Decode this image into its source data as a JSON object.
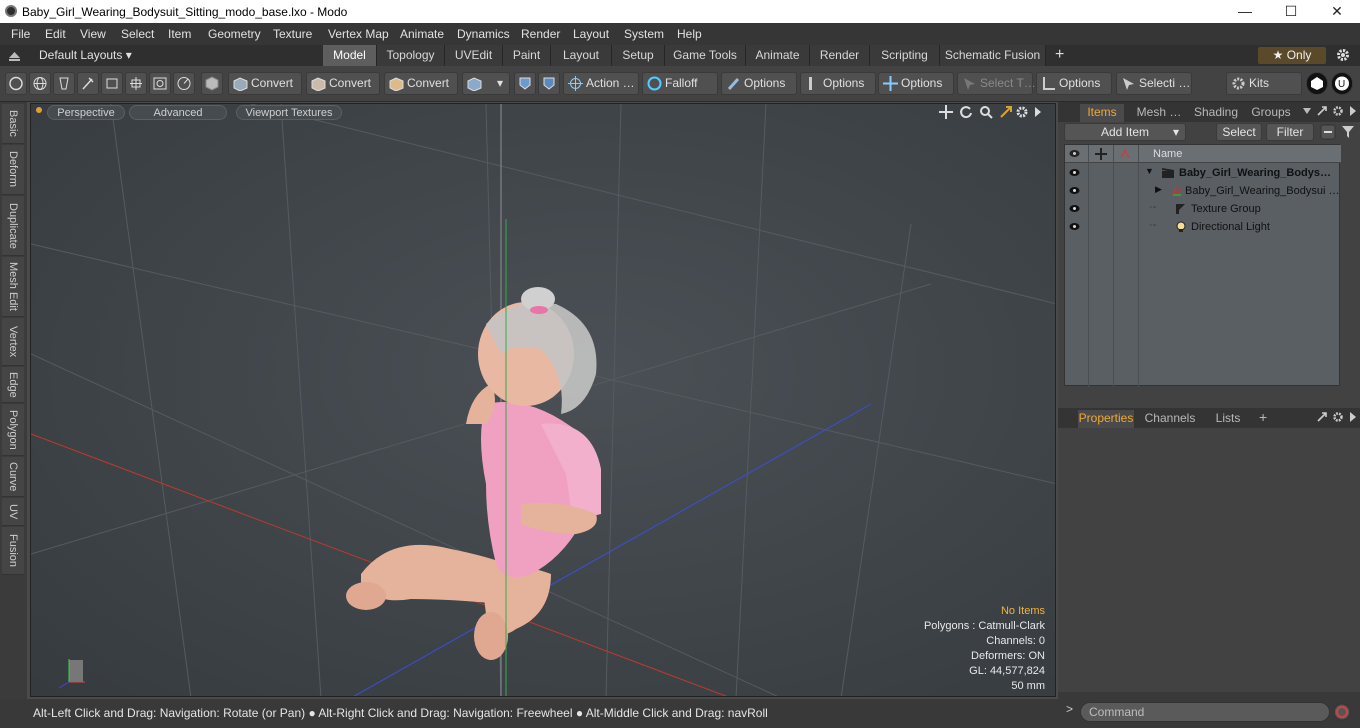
{
  "window": {
    "title": "Baby_Girl_Wearing_Bodysuit_Sitting_modo_base.lxo - Modo",
    "minimize": "—",
    "maximize": "☐",
    "close": "✕"
  },
  "menu": [
    "File",
    "Edit",
    "View",
    "Select",
    "Item",
    "Geometry",
    "Texture",
    "Vertex Map",
    "Animate",
    "Dynamics",
    "Render",
    "Layout",
    "System",
    "Help"
  ],
  "layout_bar": {
    "default_layouts": "Default Layouts ▾",
    "tabs": [
      "Model",
      "Topology",
      "UVEdit",
      "Paint",
      "Layout",
      "Setup",
      "Game Tools",
      "Animate",
      "Render",
      "Scripting",
      "Schematic Fusion"
    ],
    "active_tab": "Model",
    "add": "+",
    "only": "★  Only"
  },
  "toolbar": {
    "convert1": "Convert",
    "convert2": "Convert",
    "convert3": "Convert",
    "action": "Action  …",
    "falloff": "Falloff",
    "options1": "Options",
    "options2": "Options",
    "options3": "Options",
    "select_t": "Select T…",
    "options4": "Options",
    "selecti": "Selecti …",
    "kits": "Kits"
  },
  "left_tabs": [
    "Basic",
    "Deform",
    "Duplicate",
    "Mesh Edit",
    "Vertex",
    "Edge",
    "Polygon",
    "Curve",
    "UV",
    "Fusion"
  ],
  "viewport": {
    "perspective": "Perspective",
    "advanced": "Advanced",
    "textures": "Viewport Textures",
    "info": {
      "no_items": "No Items",
      "polygons": "Polygons : Catmull-Clark",
      "channels": "Channels: 0",
      "deformers": "Deformers: ON",
      "gl": "GL: 44,577,824",
      "size": "50 mm"
    }
  },
  "status_bar": "Alt-Left Click and Drag: Navigation: Rotate (or Pan) ● Alt-Right Click and Drag: Navigation: Freewheel ● Alt-Middle Click and Drag: navRoll",
  "items_panel": {
    "tabs": [
      "Items",
      "Mesh …",
      "Shading",
      "Groups"
    ],
    "add_item": "Add Item",
    "select": "Select",
    "filter": "Filter",
    "name_header": "Name",
    "rows": [
      {
        "name": "Baby_Girl_Wearing_Bodys…",
        "bold": true
      },
      {
        "name": "Baby_Girl_Wearing_Bodysui …",
        "bold": false
      },
      {
        "name": "Texture Group",
        "bold": false
      },
      {
        "name": "Directional Light",
        "bold": false
      }
    ]
  },
  "properties_panel": {
    "tabs": [
      "Properties",
      "Channels",
      "Lists"
    ],
    "add": "+"
  },
  "command": {
    "placeholder": "Command"
  }
}
